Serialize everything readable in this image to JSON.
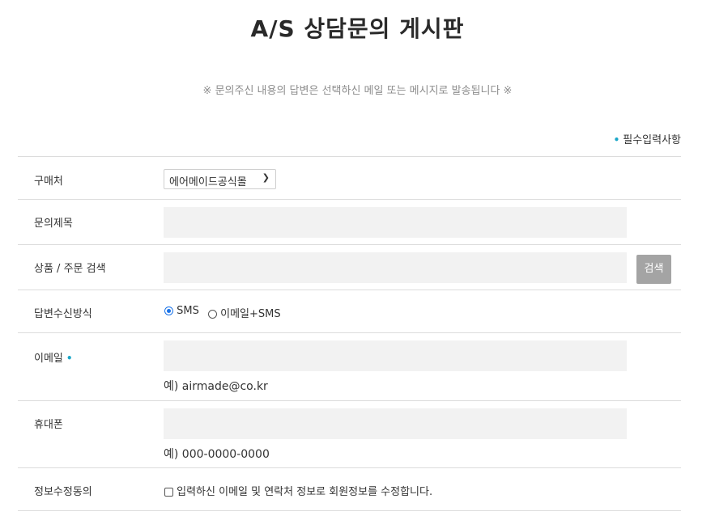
{
  "page": {
    "title": "A/S 상담문의 게시판",
    "notice": "※ 문의주신 내용의 답변은 선택하신 메일 또는 메시지로 발송됩니다 ※",
    "required_legend": "필수입력사항",
    "required_marker": "•"
  },
  "form": {
    "store": {
      "label": "구매처",
      "selected": "에어메이드공식몰"
    },
    "subject": {
      "label": "문의제목",
      "value": ""
    },
    "product_search": {
      "label": "상품 / 주문 검색",
      "value": "",
      "button": "검색"
    },
    "reply_method": {
      "label": "답변수신방식",
      "options": [
        {
          "label": "SMS",
          "checked": true
        },
        {
          "label": "이메일+SMS",
          "checked": false
        }
      ]
    },
    "email": {
      "label": "이메일",
      "value": "",
      "hint": "예) airmade@co.kr"
    },
    "phone": {
      "label": "휴대폰",
      "value": "",
      "hint": "예) 000-0000-0000"
    },
    "consent": {
      "label": "정보수정동의",
      "text": "입력하신 이메일 및 연락처 정보로 회원정보를 수정합니다."
    }
  },
  "colors": {
    "accent_dot": "#1aa6c8",
    "radio_selected": "#1a73e8",
    "input_bg": "#f2f2f2",
    "button_bg": "#a4a4a4"
  }
}
